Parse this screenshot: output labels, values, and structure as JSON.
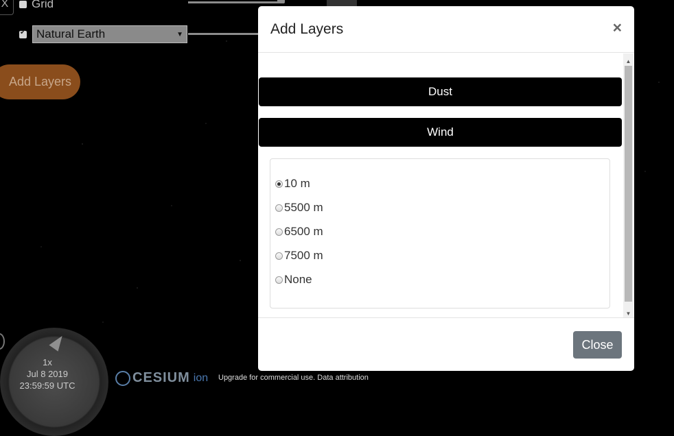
{
  "background": {
    "close_x": "X",
    "grid_label": "Grid",
    "basemap_select": "Natural Earth",
    "add_layers_label": "Add Layers"
  },
  "clock": {
    "speed": "1x",
    "date": "Jul 8 2019",
    "time": "23:59:59 UTC"
  },
  "credits": {
    "logo_word": "CESIUM",
    "logo_ion": "ion",
    "upgrade_text": "Upgrade for commercial use.  Data attribution"
  },
  "modal": {
    "title": "Add Layers",
    "close_symbol": "×",
    "layer_buttons": [
      "Dust",
      "Wind"
    ],
    "wind_options": [
      "10 m",
      "5500 m",
      "6500 m",
      "7500 m",
      "None"
    ],
    "selected_option": "10 m",
    "close_button": "Close"
  },
  "colors": {
    "add_layers_accent": "#8a4d1c",
    "close_button": "#6c757d"
  }
}
